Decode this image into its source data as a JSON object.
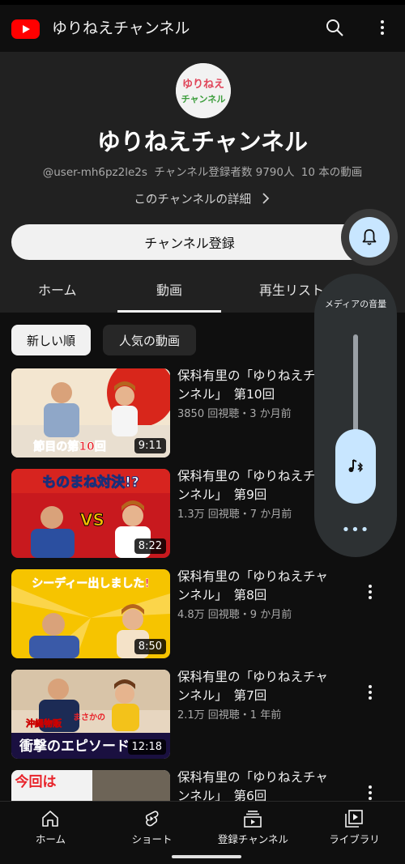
{
  "topbar": {
    "title": "ゆりねえチャンネル"
  },
  "channel": {
    "logo_text": [
      "ゆりねえ",
      "チャンネル"
    ],
    "name": "ゆりねえチャンネル",
    "handle": "@user-mh6pz2le2s",
    "subscribers": "チャンネル登録者数 9790人",
    "video_count": "10 本の動画",
    "details_link": "このチャンネルの詳細",
    "subscribe_label": "チャンネル登録"
  },
  "tabs": [
    {
      "label": "ホーム"
    },
    {
      "label": "動画"
    },
    {
      "label": "再生リスト"
    }
  ],
  "chips": [
    {
      "label": "新しい順"
    },
    {
      "label": "人気の動画"
    }
  ],
  "videos": [
    {
      "title": "保科有里の「ゆりねえチャンネル」　第10回",
      "meta": "3850 回視聴・3 か月前",
      "duration": "9:11",
      "thumb_text": "節目の第10回"
    },
    {
      "title": "保科有里の「ゆりねえチャンネル」　第9回",
      "meta": "1.3万 回視聴・7 か月前",
      "duration": "8:22",
      "thumb_text": "ものまね対決!?",
      "thumb_text2": "VS"
    },
    {
      "title": "保科有里の「ゆりねえチャンネル」　第8回",
      "meta": "4.8万 回視聴・9 か月前",
      "duration": "8:50",
      "thumb_text": "シーディー出しました!"
    },
    {
      "title": "保科有里の「ゆりねえチャンネル」　第7回",
      "meta": "2.1万 回視聴・1 年前",
      "duration": "12:18",
      "thumb_text": "衝撃のエピソード",
      "thumb_text2": "沖縄物販",
      "thumb_text3": "まさかの"
    },
    {
      "title": "保科有里の「ゆりねえチャンネル」　第6回",
      "meta": "",
      "duration": "",
      "thumb_text": "今回は"
    }
  ],
  "volume_panel": {
    "label": "メディアの音量",
    "more": "•••"
  },
  "bottom_nav": [
    {
      "label": "ホーム",
      "icon": "home-icon"
    },
    {
      "label": "ショート",
      "icon": "shorts-icon"
    },
    {
      "label": "登録チャンネル",
      "icon": "subscriptions-icon"
    },
    {
      "label": "ライブラリ",
      "icon": "library-icon"
    }
  ],
  "colors": {
    "background": "#0f0f0f",
    "header": "#212121",
    "accent_blue": "#c8e6ff",
    "youtube_red": "#ff0000"
  }
}
